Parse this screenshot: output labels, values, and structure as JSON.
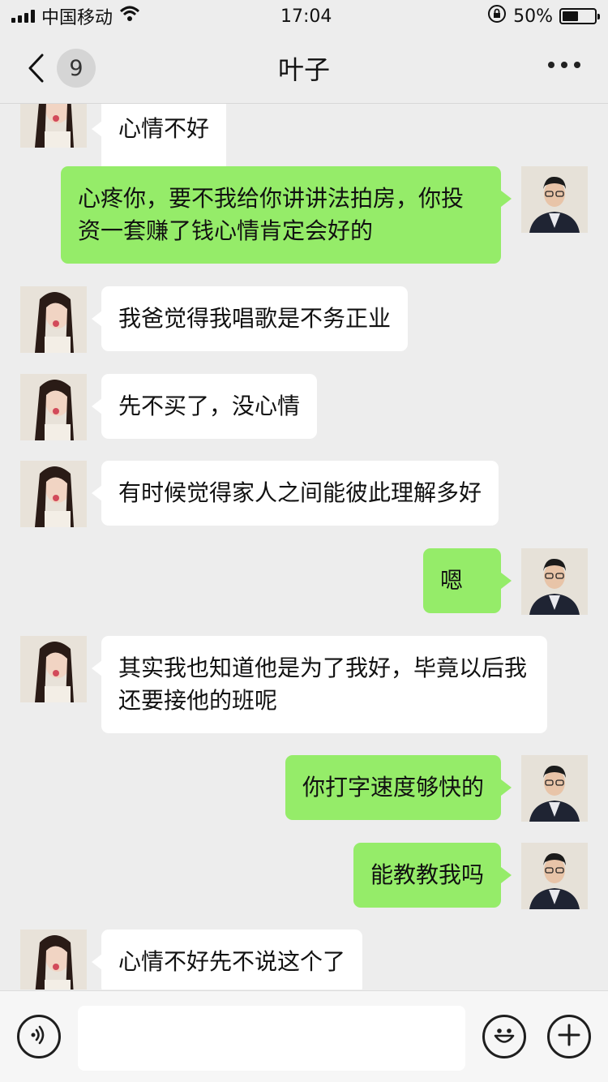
{
  "status_bar": {
    "carrier": "中国移动",
    "time": "17:04",
    "battery_percent": "50%",
    "battery_level": 0.5,
    "icons": [
      "signal-icon",
      "wifi-icon",
      "rotation-lock-icon",
      "battery-icon"
    ]
  },
  "nav": {
    "back_icon": "chevron-left-icon",
    "unread_count": "9",
    "title": "叶子",
    "more_icon": "more-icon"
  },
  "messages": [
    {
      "side": "in",
      "text": "心情不好"
    },
    {
      "side": "out",
      "text": "心疼你，要不我给你讲讲法拍房，你投\n资一套赚了钱心情肯定会好的"
    },
    {
      "side": "in",
      "text": "我爸觉得我唱歌是不务正业"
    },
    {
      "side": "in",
      "text": "先不买了，没心情"
    },
    {
      "side": "in",
      "text": "有时候觉得家人之间能彼此理解多好"
    },
    {
      "side": "out",
      "text": "嗯"
    },
    {
      "side": "in",
      "text": "其实我也知道他是为了我好，毕竟以后我\n还要接他的班呢"
    },
    {
      "side": "out",
      "text": "你打字速度够快的"
    },
    {
      "side": "out",
      "text": "能教教我吗"
    },
    {
      "side": "in",
      "text": "心情不好先不说这个了"
    }
  ],
  "input_bar": {
    "voice_icon": "voice-icon",
    "emoji_icon": "emoji-icon",
    "add_icon": "plus-icon",
    "placeholder": ""
  },
  "colors": {
    "background": "#ededed",
    "bubble_out": "#95ec69",
    "bubble_in": "#ffffff"
  }
}
